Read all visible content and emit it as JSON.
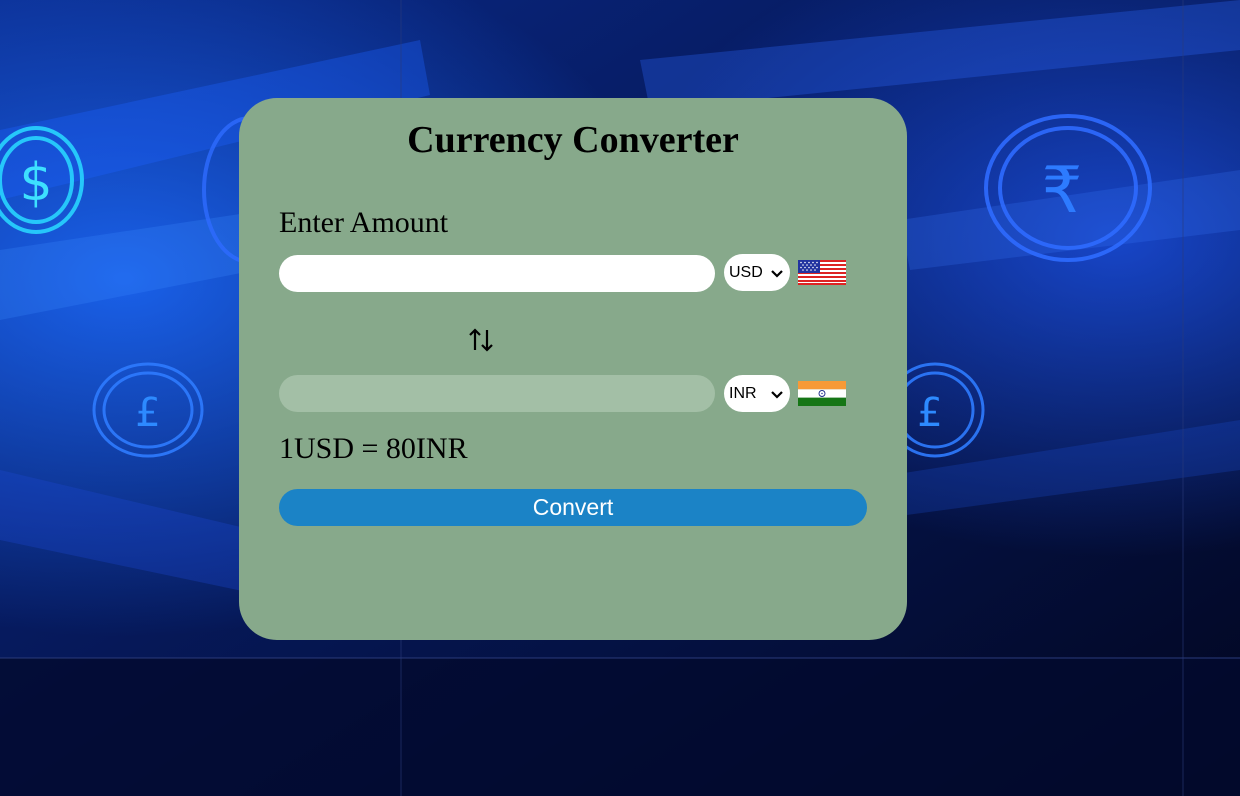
{
  "card": {
    "title": "Currency Converter",
    "amount_label": "Enter Amount",
    "amount_value": "",
    "result_value": "",
    "from_currency": "USD",
    "to_currency": "INR",
    "rate_text": "1USD = 80INR",
    "convert_label": "Convert",
    "swap_icon": "swap-vertical-icon",
    "from_flag": "us-flag-icon",
    "to_flag": "india-flag-icon"
  },
  "background": {
    "symbols": [
      "$",
      "₹",
      "£",
      "£"
    ]
  },
  "colors": {
    "card_bg": "#87a98b",
    "button_bg": "#1b83c6",
    "result_field_bg": "#a3bfa6",
    "page_bg": "#030826"
  }
}
